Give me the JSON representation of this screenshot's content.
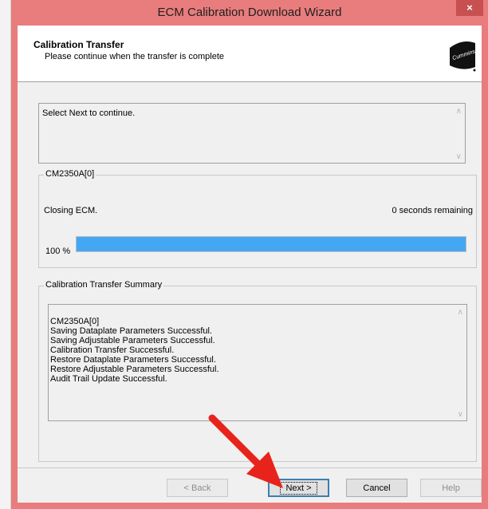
{
  "window": {
    "title": "ECM Calibration Download Wizard",
    "close_glyph": "×"
  },
  "header": {
    "title": "Calibration Transfer",
    "subtitle": "Please continue when the transfer is complete",
    "logo_icon": "cummins-logo",
    "logo_text": "Cummins"
  },
  "message": {
    "text": "Select Next to continue."
  },
  "progress_group": {
    "label": "CM2350A[0]",
    "status_text": "Closing ECM.",
    "remaining_text": "0 seconds remaining",
    "percent_label": "100 %",
    "percent_value": 100
  },
  "summary": {
    "label": "Calibration Transfer Summary",
    "lines": [
      "CM2350A[0]",
      "Saving Dataplate Parameters Successful.",
      "Saving Adjustable Parameters Successful.",
      "Calibration Transfer Successful.",
      "Restore Dataplate Parameters Successful.",
      "Restore Adjustable Parameters Successful.",
      "Audit Trail Update Successful."
    ]
  },
  "buttons": {
    "back": "< Back",
    "next": "Next >",
    "cancel": "Cancel",
    "help": "Help"
  },
  "colors": {
    "titlebar": "#e97c7c",
    "progress": "#43a7f3",
    "annotation_arrow": "#e8231c"
  }
}
